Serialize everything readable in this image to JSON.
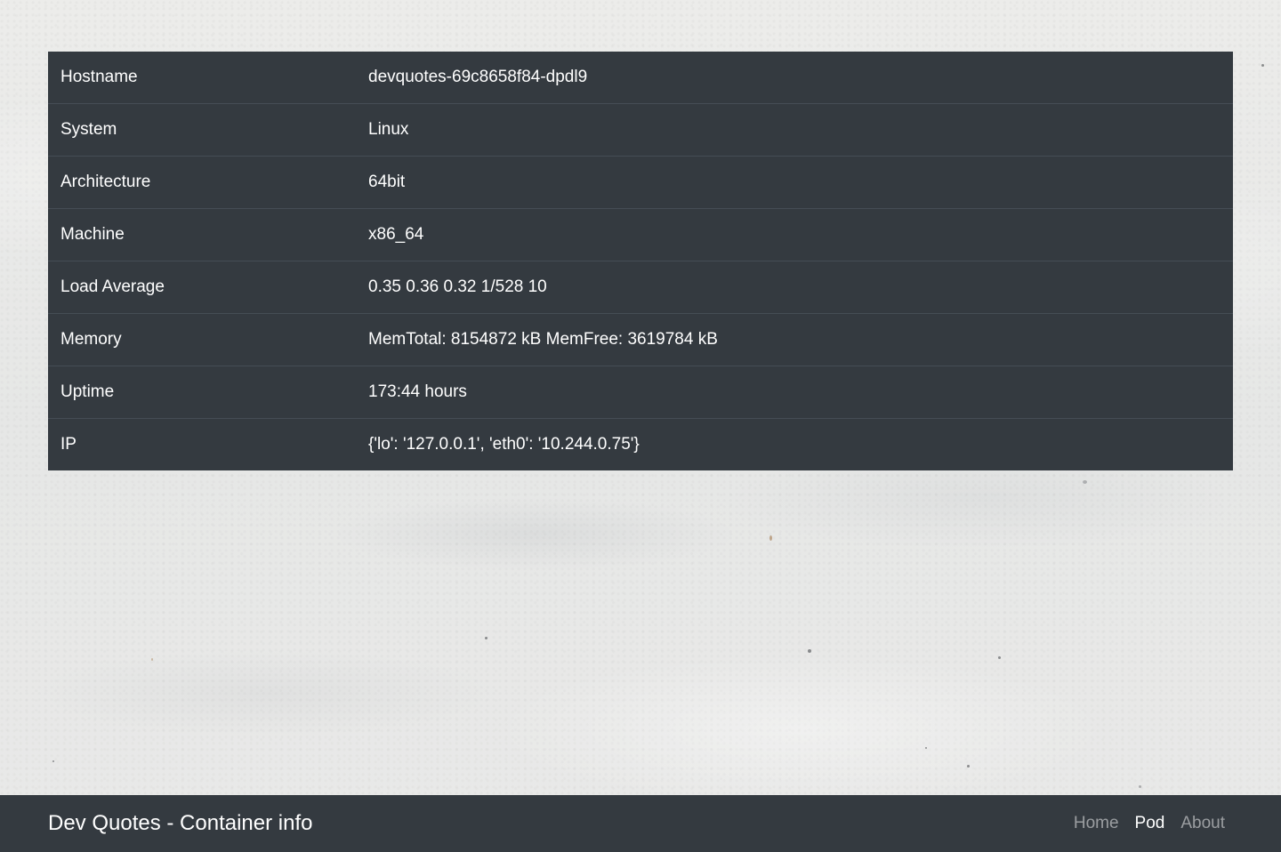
{
  "info_rows": [
    {
      "label": "Hostname",
      "value": "devquotes-69c8658f84-dpdl9"
    },
    {
      "label": "System",
      "value": "Linux"
    },
    {
      "label": "Architecture",
      "value": "64bit"
    },
    {
      "label": "Machine",
      "value": "x86_64"
    },
    {
      "label": "Load Average",
      "value": "0.35 0.36 0.32 1/528 10"
    },
    {
      "label": "Memory",
      "value": "MemTotal: 8154872 kB MemFree: 3619784 kB"
    },
    {
      "label": "Uptime",
      "value": "173:44 hours"
    },
    {
      "label": "IP",
      "value": "{'lo': '127.0.0.1', 'eth0': '10.244.0.75'}"
    }
  ],
  "navbar": {
    "brand": "Dev Quotes - Container info",
    "links": [
      {
        "label": "Home",
        "active": false
      },
      {
        "label": "Pod",
        "active": true
      },
      {
        "label": "About",
        "active": false
      }
    ]
  },
  "colors": {
    "panel_bg": "#343a40",
    "row_border": "#454d55",
    "text": "#ffffff",
    "nav_inactive": "rgba(255,255,255,0.5)",
    "page_bg": "#e9e9e7"
  }
}
